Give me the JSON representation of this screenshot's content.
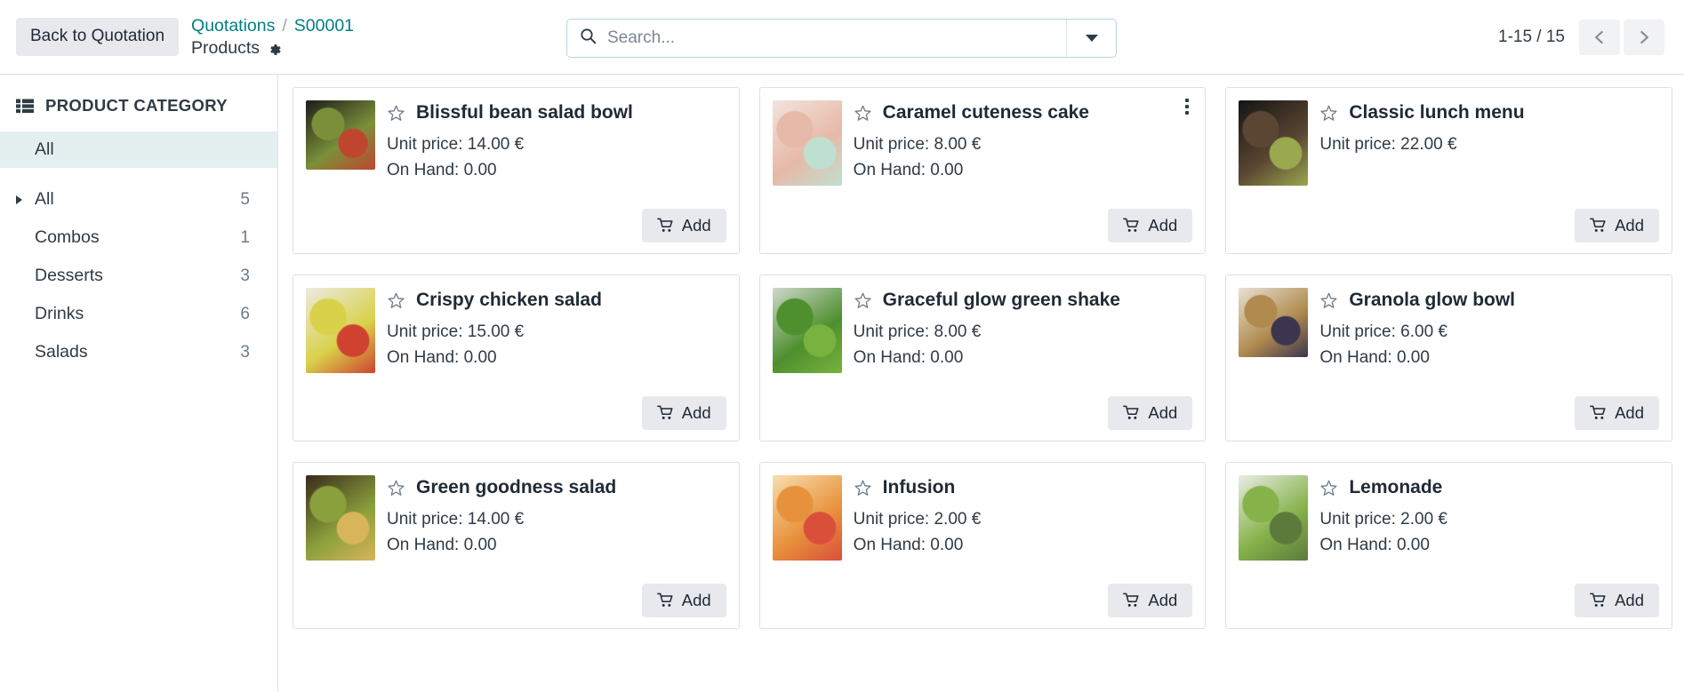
{
  "header": {
    "back_button_label": "Back to Quotation",
    "breadcrumb": {
      "parent_label": "Quotations",
      "separator": "/",
      "record_label": "S00001",
      "current_label": "Products",
      "settings_icon": "gear-icon"
    },
    "search": {
      "placeholder": "Search...",
      "value": "",
      "icon": "search-icon",
      "dropdown_icon": "chevron-down-icon"
    },
    "pager": {
      "count_label": "1-15 / 15",
      "previous_icon": "chevron-left-icon",
      "next_icon": "chevron-right-icon"
    }
  },
  "sidebar": {
    "title": "PRODUCT CATEGORY",
    "title_icon": "list-grid-icon",
    "selected_label": "All",
    "items": [
      {
        "label": "All",
        "count": "5",
        "expandable": true
      },
      {
        "label": "Combos",
        "count": "1",
        "expandable": false
      },
      {
        "label": "Desserts",
        "count": "3",
        "expandable": false
      },
      {
        "label": "Drinks",
        "count": "6",
        "expandable": false
      },
      {
        "label": "Salads",
        "count": "3",
        "expandable": false
      }
    ]
  },
  "kanban": {
    "add_label": "Add",
    "add_icon": "shopping-cart-icon",
    "favorite_icon": "star-outline-icon",
    "menu_icon": "kebab-menu-icon",
    "cards": [
      {
        "name": "Blissful bean salad bowl",
        "price_line": "Unit price: 14.00 €",
        "onhand_line": "On Hand: 0.00",
        "add_label": "Add",
        "has_menu": false,
        "thumb_colors": [
          "#1b1d1a",
          "#7b8f3a",
          "#c0452e"
        ]
      },
      {
        "name": "Caramel cuteness cake",
        "price_line": "Unit price: 8.00 €",
        "onhand_line": "On Hand: 0.00",
        "add_label": "Add",
        "has_menu": true,
        "thumb_colors": [
          "#f3e3dc",
          "#e6b9a8",
          "#bfe0d0"
        ]
      },
      {
        "name": "Classic lunch menu",
        "price_line": "Unit price: 22.00 €",
        "onhand_line": "",
        "add_label": "Add",
        "has_menu": false,
        "thumb_colors": [
          "#141414",
          "#5a4632",
          "#9aa84f"
        ]
      },
      {
        "name": "Crispy chicken salad",
        "price_line": "Unit price: 15.00 €",
        "onhand_line": "On Hand: 0.00",
        "add_label": "Add",
        "has_menu": false,
        "thumb_colors": [
          "#eceae4",
          "#d9d14a",
          "#cf4230"
        ]
      },
      {
        "name": "Graceful glow green shake",
        "price_line": "Unit price: 8.00 €",
        "onhand_line": "On Hand: 0.00",
        "add_label": "Add",
        "has_menu": false,
        "thumb_colors": [
          "#cfd8cd",
          "#4e8f2e",
          "#79b23e"
        ]
      },
      {
        "name": "Granola glow bowl",
        "price_line": "Unit price: 6.00 €",
        "onhand_line": "On Hand: 0.00",
        "add_label": "Add",
        "has_menu": false,
        "thumb_colors": [
          "#e8e1d4",
          "#b08a4e",
          "#3b3550"
        ]
      },
      {
        "name": "Green goodness salad",
        "price_line": "Unit price: 14.00 €",
        "onhand_line": "On Hand: 0.00",
        "add_label": "Add",
        "has_menu": false,
        "thumb_colors": [
          "#3a2a1d",
          "#8aa03c",
          "#d8b45a"
        ]
      },
      {
        "name": "Infusion",
        "price_line": "Unit price: 2.00 €",
        "onhand_line": "On Hand: 0.00",
        "add_label": "Add",
        "has_menu": false,
        "thumb_colors": [
          "#f7dfae",
          "#e8913c",
          "#d94f3a"
        ]
      },
      {
        "name": "Lemonade",
        "price_line": "Unit price: 2.00 €",
        "onhand_line": "On Hand: 0.00",
        "add_label": "Add",
        "has_menu": false,
        "thumb_colors": [
          "#e9ece6",
          "#86b24a",
          "#5c7a3c"
        ]
      }
    ]
  },
  "theme": {
    "accent": "#017e84",
    "selected_bg": "#e4eff0",
    "button_bg": "#e7e9ed",
    "text": "#2f3b45"
  }
}
